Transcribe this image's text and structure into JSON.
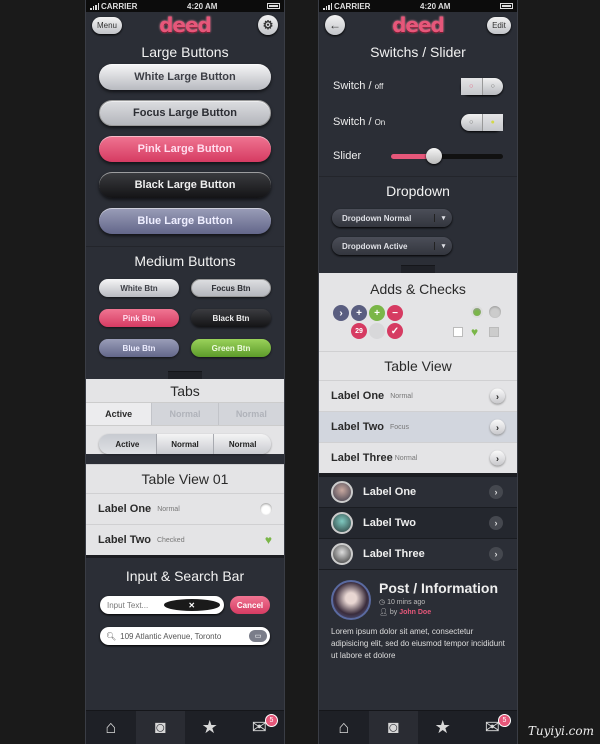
{
  "status": {
    "carrier": "CARRIER",
    "time": "4:20 AM"
  },
  "logo": "deed",
  "left": {
    "nav": {
      "menu_label": "Menu",
      "settings_icon": "gear-icon"
    },
    "large_buttons": {
      "title": "Large Buttons",
      "buttons": [
        "White Large Button",
        "Focus Large Button",
        "Pink Large Button",
        "Black Large Button",
        "Blue Large Button"
      ]
    },
    "medium_buttons": {
      "title": "Medium Buttons",
      "buttons": [
        "White Btn",
        "Focus Btn",
        "Pink Btn",
        "Black Btn",
        "Blue Btn",
        "Green Btn"
      ]
    },
    "tabs": {
      "title": "Tabs",
      "top_tabs": [
        "Active",
        "Normal",
        "Normal"
      ],
      "segmented": [
        "Active",
        "Normal",
        "Normal"
      ]
    },
    "table_view": {
      "title": "Table View 01",
      "rows": [
        {
          "label": "Label One",
          "state": "Normal"
        },
        {
          "label": "Label Two",
          "state": "Checked"
        }
      ]
    },
    "input": {
      "title": "Input & Search Bar",
      "placeholder": "Input Text...",
      "cancel_label": "Cancel",
      "search_value": "109 Atlantic Avenue, Toronto"
    }
  },
  "right": {
    "nav": {
      "back_icon": "back-arrow-icon",
      "edit_label": "Edit"
    },
    "switches": {
      "title": "Switchs / Slider",
      "switch_off_label": "Switch / ",
      "switch_off_state": "off",
      "switch_on_label": "Switch / ",
      "switch_on_state": "On",
      "slider_label": "Slider",
      "slider_value": 0.38
    },
    "dropdown": {
      "title": "Dropdown",
      "items": [
        "Dropdown Normal",
        "Dropdown Active"
      ]
    },
    "adds": {
      "title": "Adds & Checks",
      "badge_number": "29"
    },
    "table_view": {
      "title": "Table View",
      "rows": [
        {
          "label": "Label One",
          "state": "Normal"
        },
        {
          "label": "Label Two",
          "state": "Focus"
        },
        {
          "label": "Label Three",
          "state": "Normal"
        }
      ]
    },
    "avatar_list": [
      "Label One",
      "Label Two",
      "Label Three"
    ],
    "post": {
      "title": "Post / Information",
      "time": "10 mins ago",
      "by": "by",
      "author": "John Doe",
      "body": "Lorem ipsum dolor sit amet, consectetur adipisicing elit, sed do eiusmod tempor incididunt ut labore et dolore"
    }
  },
  "tabbar": {
    "badge": "5"
  },
  "colors": {
    "accent": "#e6577a",
    "bg": "#2b2e36",
    "green": "#7ab648"
  },
  "watermark": "Tuyiyi.com"
}
